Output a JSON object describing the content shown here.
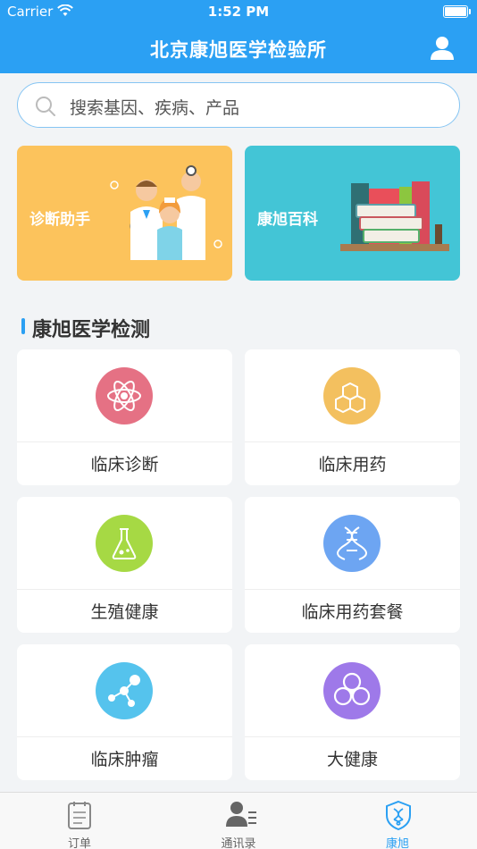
{
  "status_bar": {
    "carrier": "Carrier",
    "time": "1:52 PM",
    "battery_level": 1.0
  },
  "header": {
    "title": "北京康旭医学检验所",
    "user_icon": "user-icon"
  },
  "search": {
    "placeholder": "搜索基因、疾病、产品",
    "icon": "search-icon"
  },
  "banners": [
    {
      "label": "诊断助手",
      "color": "#fcc35c",
      "icon": "doctors-illustration"
    },
    {
      "label": "康旭百科",
      "color": "#43c5d6",
      "icon": "books-illustration"
    }
  ],
  "section": {
    "title": "康旭医学检测",
    "accent": "#2ba0f3"
  },
  "categories": [
    {
      "label": "临床诊断",
      "color": "#e57184",
      "icon": "atom-icon"
    },
    {
      "label": "临床用药",
      "color": "#f3c05f",
      "icon": "molecule-icon"
    },
    {
      "label": "生殖健康",
      "color": "#a6d944",
      "icon": "flask-icon"
    },
    {
      "label": "临床用药套餐",
      "color": "#6da5f2",
      "icon": "dna-icon"
    },
    {
      "label": "临床肿瘤",
      "color": "#55c3ed",
      "icon": "molecule-nodes-icon"
    },
    {
      "label": "大健康",
      "color": "#9e79e9",
      "icon": "biohazard-icon"
    }
  ],
  "tabs": [
    {
      "label": "订单",
      "icon": "clipboard-icon",
      "active": false
    },
    {
      "label": "通讯录",
      "icon": "contacts-icon",
      "active": false
    },
    {
      "label": "康旭",
      "icon": "shield-dna-icon",
      "active": true
    }
  ],
  "colors": {
    "brand": "#2ba0f3",
    "background": "#f2f4f6"
  }
}
